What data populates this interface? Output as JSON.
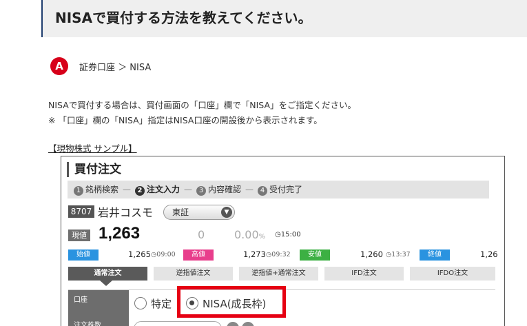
{
  "question": {
    "title": "NISAで買付する方法を教えてください。"
  },
  "answer": {
    "badge": "A",
    "breadcrumb": "証券口座 ＞ NISA",
    "line1": "NISAで買付する場合は、買付画面の「口座」欄で「NISA」をご指定ください。",
    "line2": "※ 「口座」欄の「NISA」指定はNISA口座の開設後から表示されます。",
    "sample_label": "【現物株式 サンプル】"
  },
  "order": {
    "title": "買付注文",
    "steps": [
      {
        "num": "1",
        "label": "銘柄検索",
        "active": false
      },
      {
        "num": "2",
        "label": "注文入力",
        "active": true
      },
      {
        "num": "3",
        "label": "内容確認",
        "active": false
      },
      {
        "num": "4",
        "label": "受付完了",
        "active": false
      }
    ],
    "step_sep": "—",
    "stock": {
      "code": "8707",
      "name": "岩井コスモ",
      "market": "東証",
      "current_label": "現値",
      "current_price": "1,263",
      "change": "0",
      "change_pct": "0.00",
      "pct_unit": "%",
      "time": "15:00"
    },
    "ohlc": [
      {
        "label": "始値",
        "value": "1,265",
        "time": "09:00",
        "color": "#2a93e0"
      },
      {
        "label": "高値",
        "value": "1,273",
        "time": "09:32",
        "color": "#e83e8c"
      },
      {
        "label": "安値",
        "value": "1,260",
        "time": "13:37",
        "color": "#3cb043"
      },
      {
        "label": "終値",
        "value": "1,26",
        "time": "",
        "color": "#2a93e0"
      }
    ],
    "tabs": [
      "通常注文",
      "逆指値注文",
      "逆指値+通常注文",
      "IFD注文",
      "IFDO注文"
    ],
    "account_label": "口座",
    "options": [
      {
        "label": "特定",
        "selected": false
      },
      {
        "label": "NISA(成長枠)",
        "selected": true
      }
    ],
    "qty_label": "注文株数",
    "highlight_color": "#e60012"
  }
}
